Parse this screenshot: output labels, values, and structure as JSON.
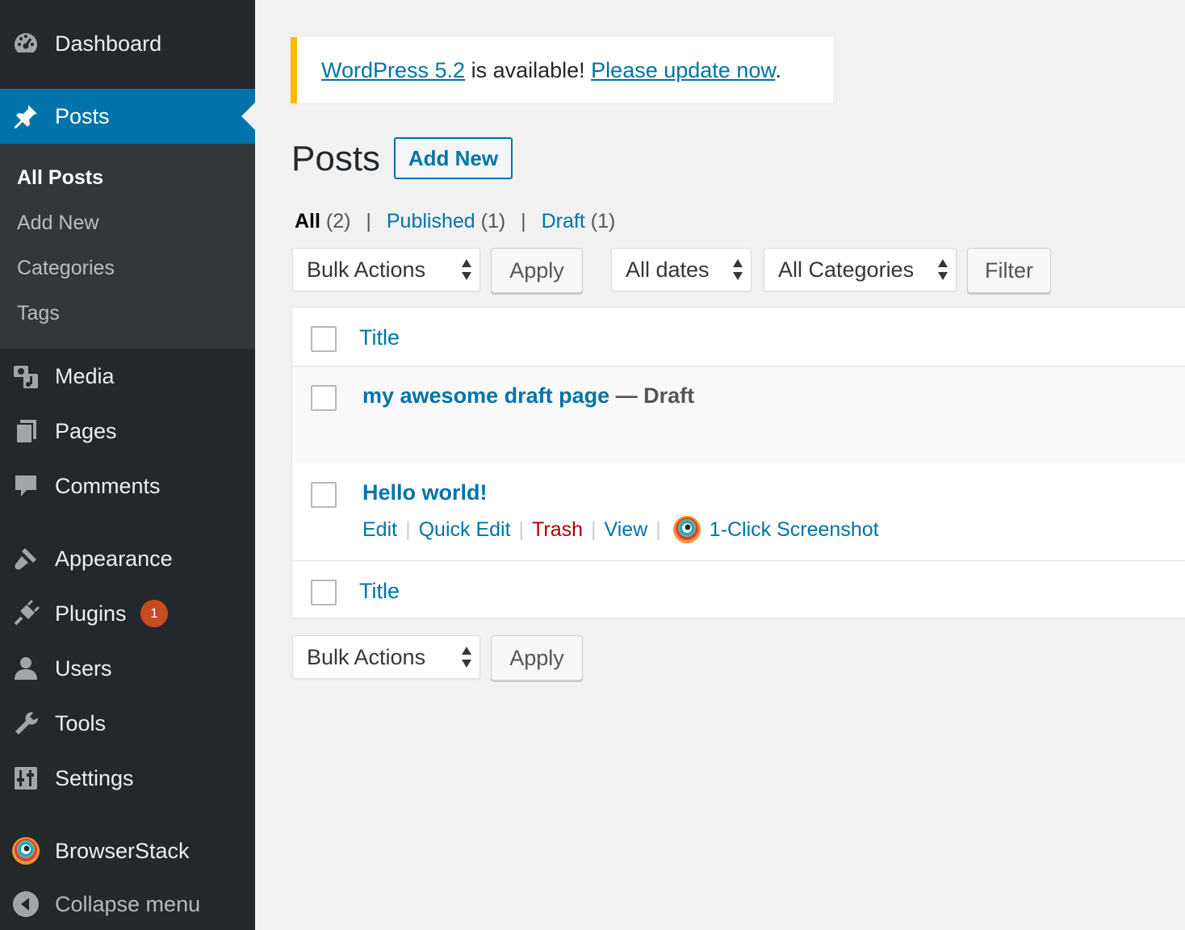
{
  "sidebar": {
    "dashboard": "Dashboard",
    "posts": "Posts",
    "submenu": {
      "all_posts": "All Posts",
      "add_new": "Add New",
      "categories": "Categories",
      "tags": "Tags"
    },
    "media": "Media",
    "pages": "Pages",
    "comments": "Comments",
    "appearance": "Appearance",
    "plugins": "Plugins",
    "plugins_badge": "1",
    "users": "Users",
    "tools": "Tools",
    "settings": "Settings",
    "browserstack": "BrowserStack",
    "collapse": "Collapse menu"
  },
  "notice": {
    "version_link": "WordPress 5.2",
    "text": " is available! ",
    "update_link": "Please update now",
    "period": "."
  },
  "header": {
    "title": "Posts",
    "add_new": "Add New"
  },
  "filters_links": {
    "all": "All",
    "all_count": "(2)",
    "published": "Published",
    "published_count": "(1)",
    "draft": "Draft",
    "draft_count": "(1)",
    "separator": "|"
  },
  "toolbar_top": {
    "bulk_actions": "Bulk Actions",
    "apply": "Apply",
    "dates": "All dates",
    "categories": "All Categories",
    "filter": "Filter"
  },
  "table": {
    "header_title": "Title",
    "footer_title": "Title",
    "rows": [
      {
        "title": "my awesome draft page",
        "state": " — Draft"
      },
      {
        "title": "Hello world!"
      }
    ],
    "row_actions": {
      "edit": "Edit",
      "quick_edit": "Quick Edit",
      "trash": "Trash",
      "view": "View",
      "screenshot": "1-Click Screenshot",
      "separator": "|"
    }
  },
  "toolbar_bottom": {
    "bulk_actions": "Bulk Actions",
    "apply": "Apply"
  },
  "colors": {
    "sidebar_bg": "#23282d",
    "submenu_bg": "#32373c",
    "accent": "#0073aa",
    "notice_border": "#ffb900",
    "badge": "#ca4a1f",
    "trash": "#aa0000"
  }
}
